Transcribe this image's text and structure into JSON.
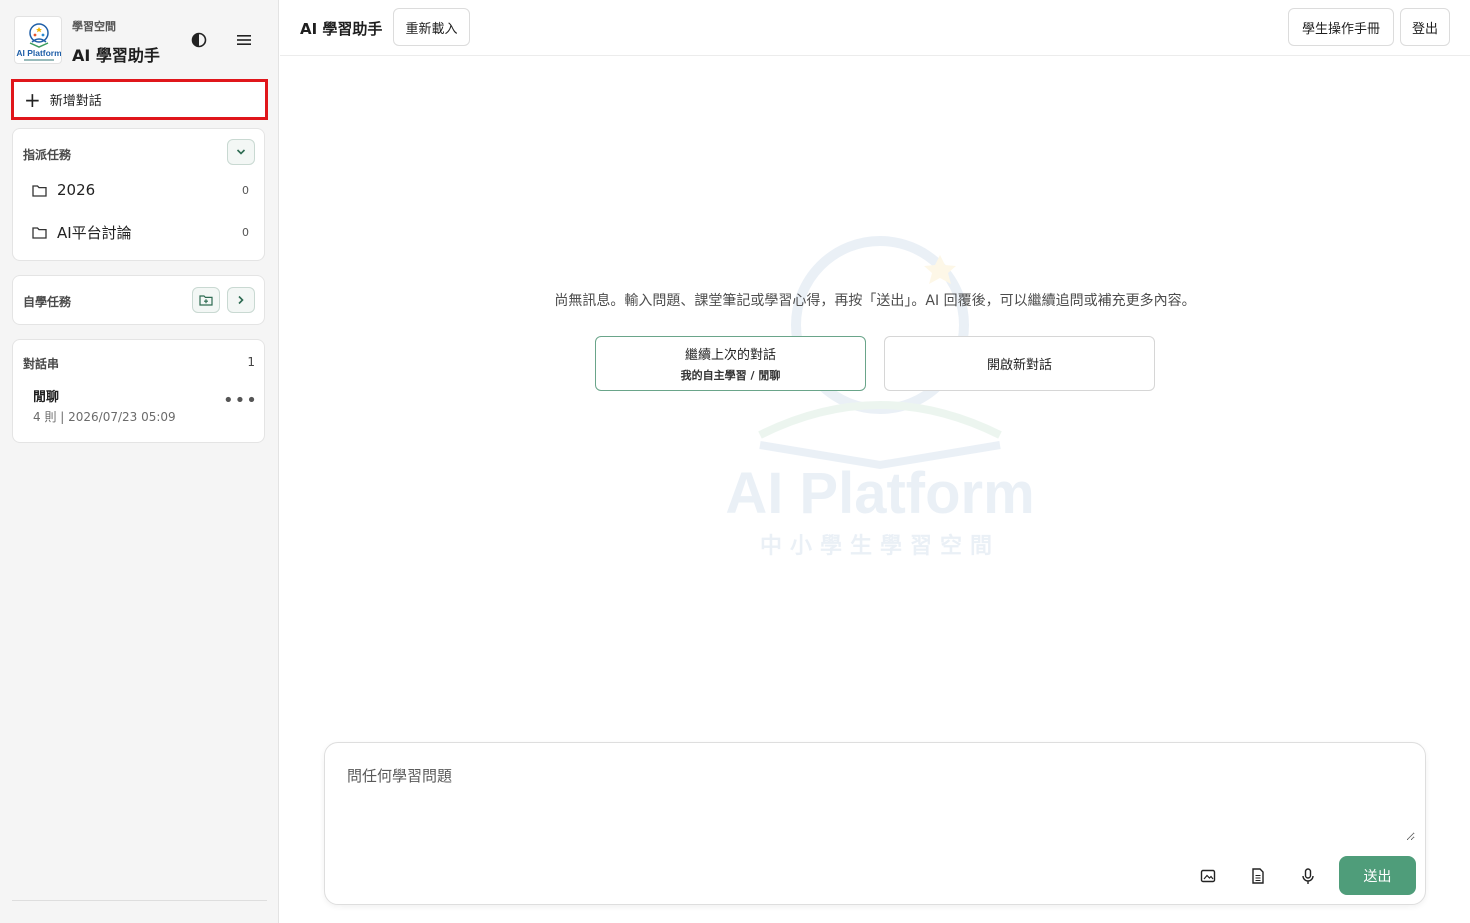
{
  "sidebar": {
    "brand_sub": "學習空間",
    "brand_title": "AI 學習助手",
    "logo_alt": "AI Platform",
    "theme_icon": "contrast-icon",
    "menu_icon": "hamburger-menu-icon",
    "new_chat_label": "新增對話",
    "assigned": {
      "title": "指派任務",
      "folders": [
        {
          "name": "2026",
          "count": "0"
        },
        {
          "name": "AI平台討論",
          "count": "0"
        }
      ]
    },
    "self_study": {
      "title": "自學任務"
    },
    "threads": {
      "title": "對話串",
      "count": "1",
      "items": [
        {
          "title": "閒聊",
          "meta": "4 則 | 2026/07/23 05:09"
        }
      ]
    }
  },
  "header": {
    "title": "AI 學習助手",
    "reload_label": "重新載入",
    "manual_label": "學生操作手冊",
    "logout_label": "登出"
  },
  "main": {
    "watermark_title": "AI Platform",
    "watermark_sub": "中小學生學習空間",
    "empty_message": "尚無訊息。輸入問題、課堂筆記或學習心得，再按「送出」。AI 回覆後，可以繼續追問或補充更多內容。",
    "continue_title": "繼續上次的對話",
    "continue_sub": "我的自主學習 / 閒聊",
    "new_chat_title": "開啟新對話"
  },
  "composer": {
    "placeholder": "問任何學習問題",
    "send_label": "送出"
  },
  "colors": {
    "accent": "#4f9d7a",
    "highlight": "#e0161b"
  }
}
